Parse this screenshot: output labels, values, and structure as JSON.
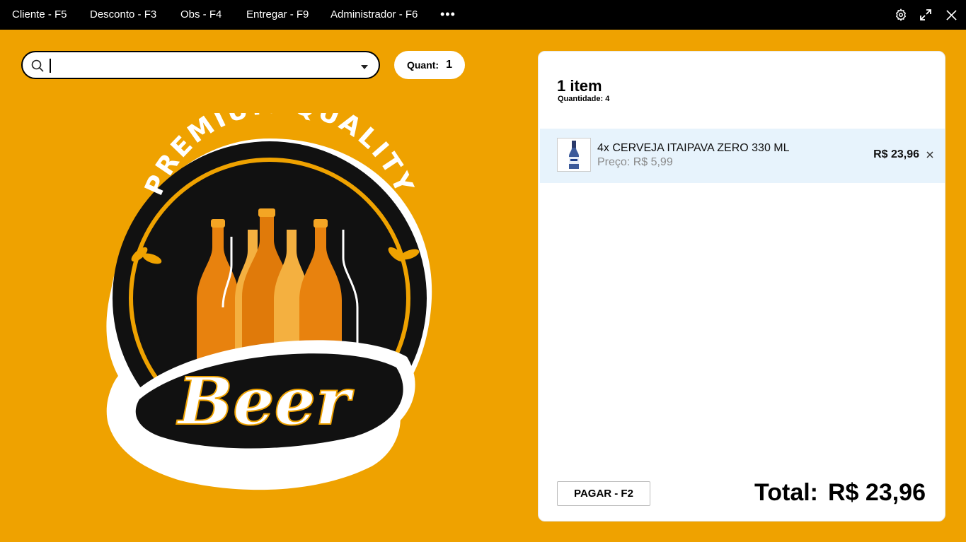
{
  "topbar": {
    "menu": [
      {
        "label": "Cliente - F5"
      },
      {
        "label": "Desconto - F3"
      },
      {
        "label": "Obs - F4"
      },
      {
        "label": "Entregar - F9"
      },
      {
        "label": "Administrador - F6"
      }
    ],
    "more_icon": "ellipsis-icon",
    "right_icons": [
      "gear-icon",
      "expand-icon",
      "close-icon"
    ]
  },
  "search": {
    "value": "",
    "placeholder": "",
    "icon": "search-icon",
    "dropdown_icon": "caret-down-icon"
  },
  "quantity": {
    "label": "Quant:",
    "value": "1"
  },
  "logo": {
    "arc_text": "PREMIUM QUALITY",
    "script_text": "Beer"
  },
  "cart": {
    "item_count": "1 item",
    "quantity_label": "Quantidade: 4",
    "items": [
      {
        "name": "4x CERVEJA ITAIPAVA ZERO 330 ML",
        "unit_price": "Preço: R$ 5,99",
        "total": "R$ 23,96"
      }
    ],
    "pay_button": "PAGAR - F2",
    "total_label": "Total:",
    "total_value": "R$ 23,96"
  },
  "colors": {
    "background": "#EFA200",
    "topbar": "#000000",
    "selected_row": "#E7F3FC"
  }
}
